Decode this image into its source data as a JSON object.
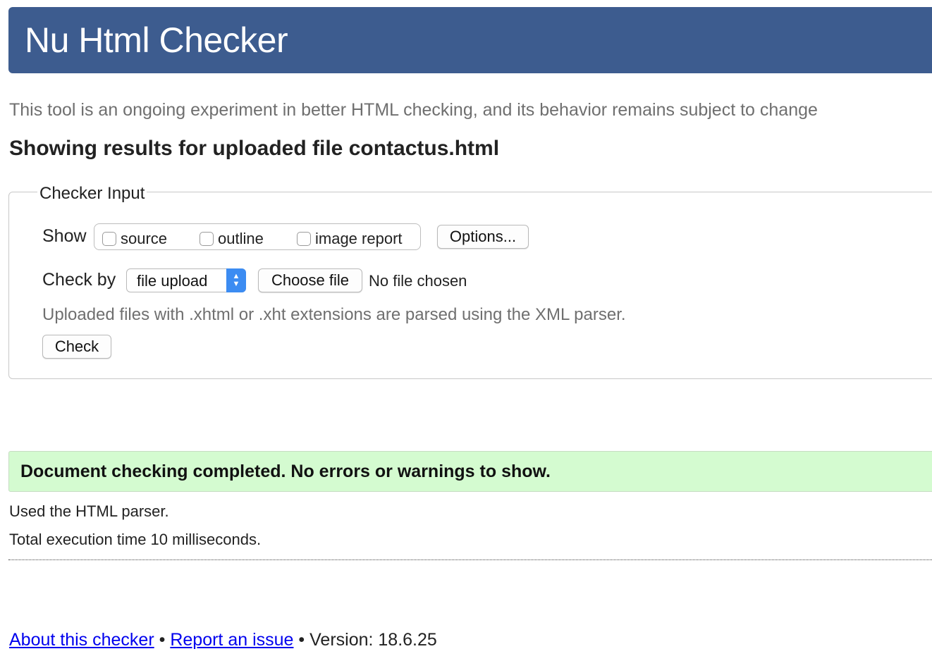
{
  "header": {
    "title": "Nu Html Checker"
  },
  "intro": "This tool is an ongoing experiment in better HTML checking, and its behavior remains subject to change",
  "results_title": "Showing results for uploaded file contactus.html",
  "checker_input": {
    "legend": "Checker Input",
    "show_label": "Show",
    "checkboxes": {
      "source": "source",
      "outline": "outline",
      "image_report": "image report"
    },
    "options_button": "Options...",
    "check_by_label": "Check by",
    "check_by_value": "file upload",
    "choose_file_button": "Choose file",
    "no_file_text": "No file chosen",
    "hint": "Uploaded files with .xhtml or .xht extensions are parsed using the XML parser.",
    "check_button": "Check"
  },
  "result": {
    "message": "Document checking completed. No errors or warnings to show.",
    "parser_info": "Used the HTML parser.",
    "execution_time": "Total execution time 10 milliseconds."
  },
  "footer": {
    "about_link": "About this checker",
    "separator": "•",
    "report_link": "Report an issue",
    "version_text": "Version: 18.6.25"
  },
  "colors": {
    "header_bg": "#3d5c8f",
    "success_bg": "#d4fbd0",
    "link": "#0000ee",
    "select_accent": "#3c8cf2"
  }
}
